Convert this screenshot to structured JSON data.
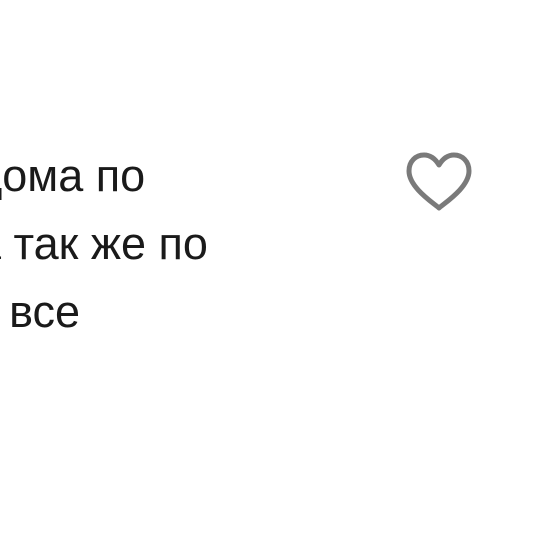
{
  "comment": {
    "lines": [
      "дома по",
      "а так же по",
      "т все"
    ]
  },
  "like_button": {
    "icon": "heart-outline-icon",
    "color": "#7a7a7a"
  }
}
